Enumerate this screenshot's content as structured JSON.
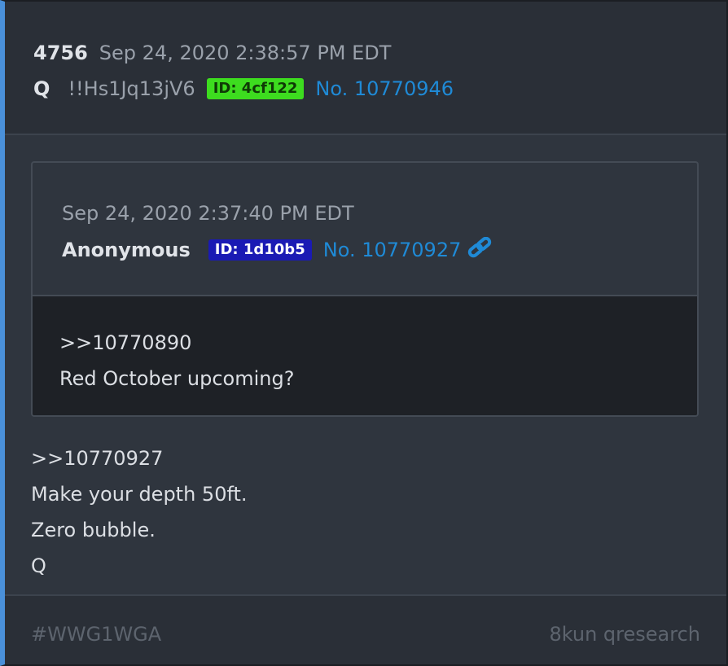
{
  "post": {
    "number": "4756",
    "timestamp": "Sep 24, 2020 2:38:57 PM EDT",
    "author": "Q",
    "tripcode": "!!Hs1Jq13jV6",
    "id_badge": "ID: 4cf122",
    "post_no": "No. 10770946"
  },
  "quoted": {
    "timestamp": "Sep 24, 2020 2:37:40 PM EDT",
    "author": "Anonymous",
    "id_badge": "ID: 1d10b5",
    "post_no": "No. 10770927",
    "link_icon": "link-icon",
    "body": [
      ">>10770890",
      "Red October upcoming?"
    ]
  },
  "body": [
    ">>10770927",
    "Make your depth 50ft.",
    "Zero bubble.",
    "Q"
  ],
  "footer": {
    "hashtag": "#WWG1WGA",
    "source": "8kun qresearch"
  },
  "colors": {
    "accent_border": "#4a90d9",
    "id_badge_green": "#3ddc1f",
    "id_badge_blue": "#1a1ab4",
    "link_blue": "#1f8ad6"
  }
}
